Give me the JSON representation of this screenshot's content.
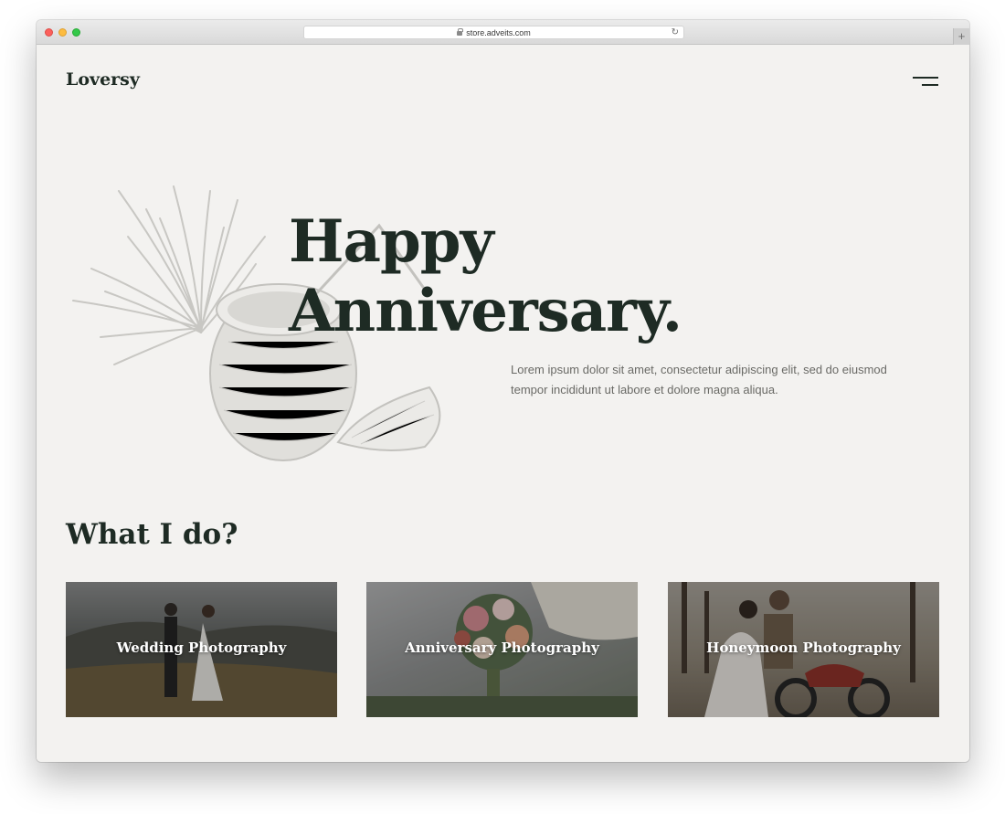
{
  "browser": {
    "url": "store.adveits.com",
    "new_tab_symbol": "+",
    "reload_symbol": "↻"
  },
  "site": {
    "logo": "Loversy",
    "menu_icon": "hamburger-menu-icon"
  },
  "hero": {
    "title_line1": "Happy",
    "title_line2": "Anniversary.",
    "description": "Lorem ipsum dolor sit amet, consectetur adipiscing elit, sed do eiusmod tempor incididunt ut labore et dolore magna aliqua.",
    "illustration": "coconut-palm-illustration"
  },
  "services": {
    "title": "What I do?",
    "cards": [
      {
        "label": "Wedding Photography",
        "image": "couple-field-photo"
      },
      {
        "label": "Anniversary Photography",
        "image": "flower-bouquet-photo"
      },
      {
        "label": "Honeymoon Photography",
        "image": "couple-motorcycle-photo"
      }
    ]
  },
  "colors": {
    "page_bg": "#f3f2f0",
    "heading": "#1e2b24",
    "body_text": "#6a6a66",
    "illustration": "#c8c7c3"
  }
}
